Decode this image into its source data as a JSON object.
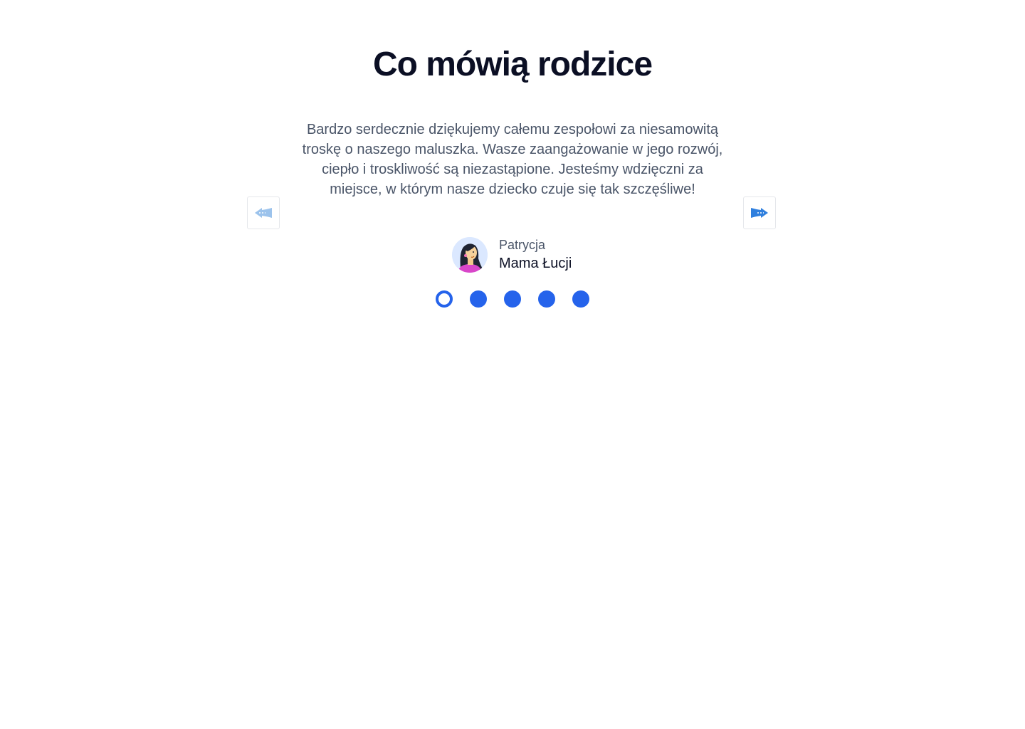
{
  "section": {
    "title": "Co mówią rodzice"
  },
  "testimonial": {
    "quote": "Bardzo serdecznie dziękujemy całemu zespołowi za niesamowitą troskę o naszego maluszka. Wasze zaangażowanie w jego rozwój, ciepło i troskliwość są niezastąpione. Jesteśmy wdzięczni za miejsce, w którym nasze dziecko czuje się tak szczęśliwe!",
    "author_name": "Patrycja",
    "author_role": "Mama Łucji"
  },
  "navigation": {
    "prev_icon": "arrow-left-icon",
    "next_icon": "arrow-right-icon",
    "prev_color": "#9cc3ec",
    "next_color": "#2f7fde"
  },
  "pagination": {
    "total": 5,
    "active_index": 0,
    "color": "#2563eb"
  },
  "colors": {
    "heading": "#0b0f24",
    "body_text": "#4a5568",
    "accent": "#2563eb"
  }
}
